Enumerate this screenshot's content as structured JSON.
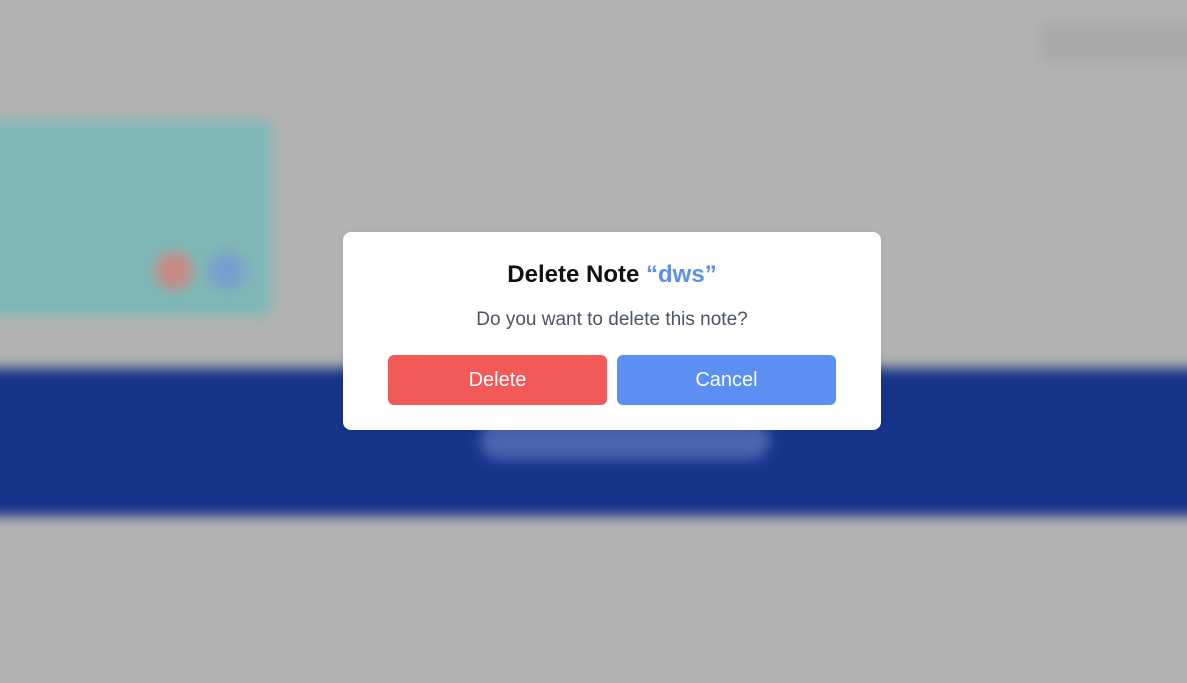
{
  "dialog": {
    "title_prefix": "Delete Note",
    "note_name": "“dws”",
    "message": "Do you want to delete this note?",
    "delete_label": "Delete",
    "cancel_label": "Cancel"
  },
  "colors": {
    "delete_button": "#f25a5a",
    "cancel_button": "#5b8ff2",
    "note_name": "#5b8ff1",
    "overlay": "#b3b3b3"
  }
}
